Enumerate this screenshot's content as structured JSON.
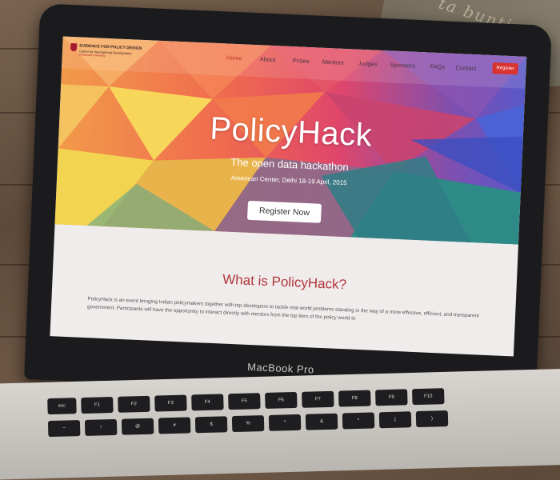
{
  "bag": {
    "text": "ta buntiner"
  },
  "device": {
    "label": "MacBook Pro"
  },
  "nav": {
    "logo_title": "EVIDENCE FOR POLICY DESIGN",
    "logo_sub": "Center for International Development",
    "logo_sub2": "at Harvard University",
    "items": [
      "Home",
      "About",
      "Prizes",
      "Mentors",
      "Judges",
      "Sponsors",
      "FAQs",
      "Contact"
    ],
    "register": "Register"
  },
  "hero": {
    "title": "PolicyHack",
    "subtitle": "The open data hackathon",
    "meta": "American Center, Delhi 18-19 April, 2015",
    "cta": "Register Now"
  },
  "about": {
    "title": "What is PolicyHack?",
    "text": "PolicyHack is an event bringing Indian policymakers together with top developers to tackle real-world problems standing in the way of a more effective, efficient, and transparent government. Participants will have the opportunity to interact directly with mentors from the top tiers of the policy world to"
  },
  "colors": {
    "accent": "#d9322f",
    "title_red": "#b2343a",
    "harvard": "#a51c30"
  },
  "keyboard": {
    "row1": [
      "esc",
      "F1",
      "F2",
      "F3",
      "F4",
      "F5",
      "F6",
      "F7",
      "F8",
      "F9",
      "F10"
    ],
    "row2": [
      "~",
      "!",
      "@",
      "#",
      "$",
      "%",
      "^",
      "&",
      "*",
      "(",
      ")"
    ]
  }
}
